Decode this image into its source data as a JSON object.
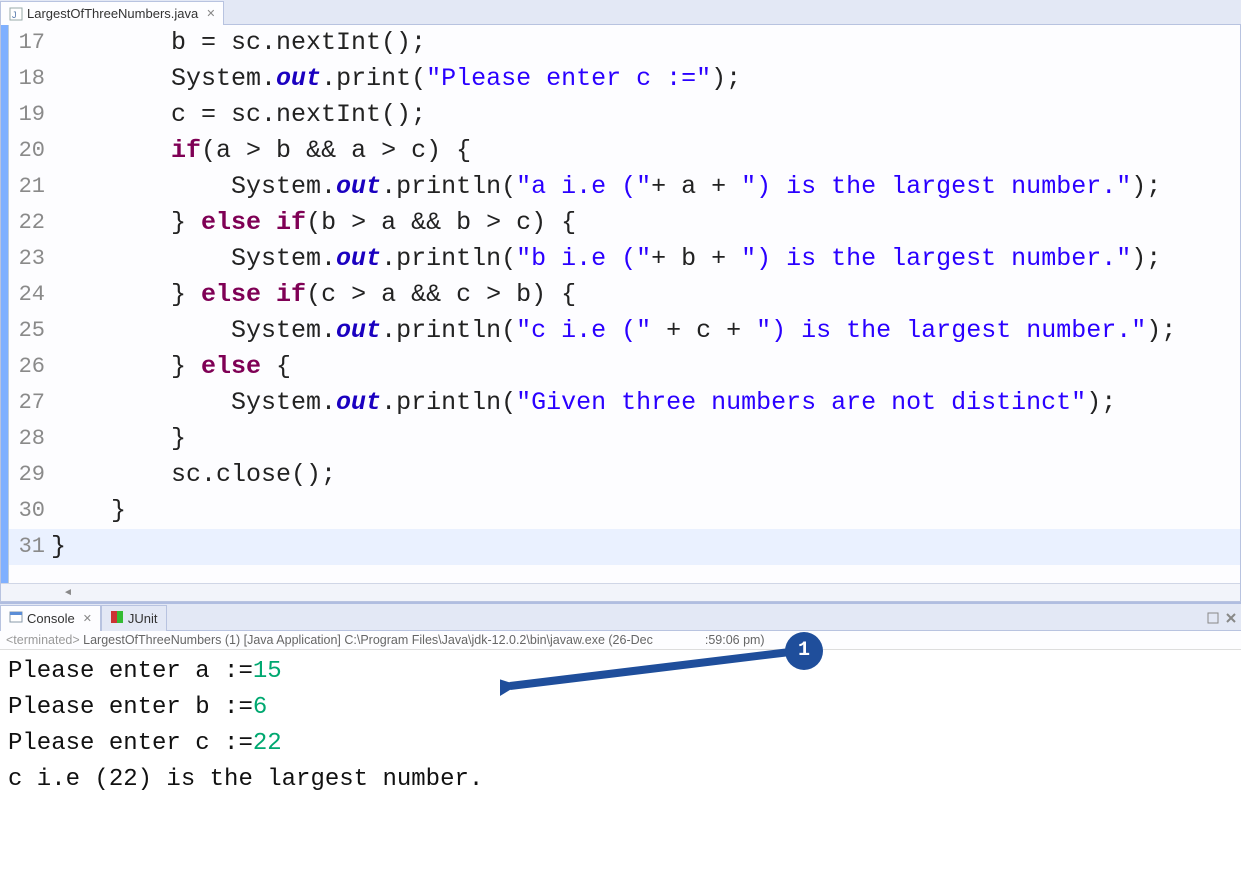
{
  "editorTab": {
    "label": "LargestOfThreeNumbers.java"
  },
  "code": {
    "lines": [
      {
        "n": "17",
        "tokens": [
          {
            "t": "        b = sc.nextInt();",
            "c": ""
          }
        ]
      },
      {
        "n": "18",
        "tokens": [
          {
            "t": "        System.",
            "c": ""
          },
          {
            "t": "out",
            "c": "fi"
          },
          {
            "t": ".print(",
            "c": ""
          },
          {
            "t": "\"Please enter c :=\"",
            "c": "str"
          },
          {
            "t": ");",
            "c": ""
          }
        ]
      },
      {
        "n": "19",
        "tokens": [
          {
            "t": "        c = sc.nextInt();",
            "c": ""
          }
        ]
      },
      {
        "n": "20",
        "tokens": [
          {
            "t": "        ",
            "c": ""
          },
          {
            "t": "if",
            "c": "kw"
          },
          {
            "t": "(a > b && a > c) {",
            "c": ""
          }
        ]
      },
      {
        "n": "21",
        "tokens": [
          {
            "t": "            System.",
            "c": ""
          },
          {
            "t": "out",
            "c": "fi"
          },
          {
            "t": ".println(",
            "c": ""
          },
          {
            "t": "\"a i.e (\"",
            "c": "str"
          },
          {
            "t": "+ a + ",
            "c": ""
          },
          {
            "t": "\") is the largest number.\"",
            "c": "str"
          },
          {
            "t": ");",
            "c": ""
          }
        ]
      },
      {
        "n": "22",
        "tokens": [
          {
            "t": "        } ",
            "c": ""
          },
          {
            "t": "else if",
            "c": "kw"
          },
          {
            "t": "(b > a && b > c) {",
            "c": ""
          }
        ]
      },
      {
        "n": "23",
        "tokens": [
          {
            "t": "            System.",
            "c": ""
          },
          {
            "t": "out",
            "c": "fi"
          },
          {
            "t": ".println(",
            "c": ""
          },
          {
            "t": "\"b i.e (\"",
            "c": "str"
          },
          {
            "t": "+ b + ",
            "c": ""
          },
          {
            "t": "\") is the largest number.\"",
            "c": "str"
          },
          {
            "t": ");",
            "c": ""
          }
        ]
      },
      {
        "n": "24",
        "tokens": [
          {
            "t": "        } ",
            "c": ""
          },
          {
            "t": "else if",
            "c": "kw"
          },
          {
            "t": "(c > a && c > b) {",
            "c": ""
          }
        ]
      },
      {
        "n": "25",
        "tokens": [
          {
            "t": "            System.",
            "c": ""
          },
          {
            "t": "out",
            "c": "fi"
          },
          {
            "t": ".println(",
            "c": ""
          },
          {
            "t": "\"c i.e (\"",
            "c": "str"
          },
          {
            "t": " + c + ",
            "c": ""
          },
          {
            "t": "\") is the largest number.\"",
            "c": "str"
          },
          {
            "t": ");",
            "c": ""
          }
        ]
      },
      {
        "n": "26",
        "tokens": [
          {
            "t": "        } ",
            "c": ""
          },
          {
            "t": "else",
            "c": "kw"
          },
          {
            "t": " {",
            "c": ""
          }
        ]
      },
      {
        "n": "27",
        "tokens": [
          {
            "t": "            System.",
            "c": ""
          },
          {
            "t": "out",
            "c": "fi"
          },
          {
            "t": ".println(",
            "c": ""
          },
          {
            "t": "\"Given three numbers are not distinct\"",
            "c": "str"
          },
          {
            "t": ");",
            "c": ""
          }
        ]
      },
      {
        "n": "28",
        "tokens": [
          {
            "t": "        }",
            "c": ""
          }
        ]
      },
      {
        "n": "29",
        "tokens": [
          {
            "t": "        sc.close();",
            "c": ""
          }
        ]
      },
      {
        "n": "30",
        "tokens": [
          {
            "t": "    }",
            "c": ""
          }
        ]
      },
      {
        "n": "31",
        "hl": true,
        "tokens": [
          {
            "t": "}",
            "c": ""
          }
        ]
      }
    ]
  },
  "bottomTabs": {
    "console": "Console",
    "junit": "JUnit"
  },
  "status": {
    "prefix": "<terminated>",
    "text": " LargestOfThreeNumbers (1) [Java Application] C:\\Program Files\\Java\\jdk-12.0.2\\bin\\javaw.exe (26-Dec",
    "suffix": ":59:06 pm)"
  },
  "console": {
    "lines": [
      {
        "prompt": "Please enter a :=",
        "input": "15"
      },
      {
        "prompt": "Please enter b :=",
        "input": "6"
      },
      {
        "prompt": "Please enter c :=",
        "input": "22"
      },
      {
        "prompt": "c i.e (22) is the largest number.",
        "input": ""
      }
    ]
  },
  "annotation": {
    "badge": "1"
  }
}
